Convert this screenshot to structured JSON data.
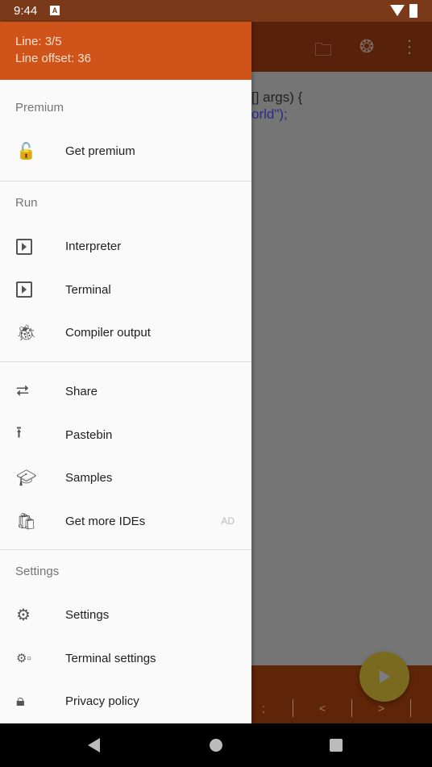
{
  "status_bar": {
    "time": "9:44",
    "notification": "A"
  },
  "editor": {
    "line1": "[] args) {",
    "line2": "orld\");"
  },
  "bottom_bar": {
    "symbols": [
      ";",
      "<",
      ">"
    ]
  },
  "drawer": {
    "header": {
      "line": "Line: 3/5",
      "offset": "Line offset: 36"
    },
    "sections": [
      {
        "title": "Premium",
        "items": [
          {
            "label": "Get premium",
            "icon": "lock-open-icon"
          }
        ]
      },
      {
        "title": "Run",
        "items": [
          {
            "label": "Interpreter",
            "icon": "play-box-icon"
          },
          {
            "label": "Terminal",
            "icon": "play-box-icon"
          },
          {
            "label": "Compiler output",
            "icon": "bug-icon"
          }
        ]
      },
      {
        "title": "",
        "items": [
          {
            "label": "Share",
            "icon": "share-icon"
          },
          {
            "label": "Pastebin",
            "icon": "upload-icon"
          },
          {
            "label": "Samples",
            "icon": "school-icon"
          },
          {
            "label": "Get more IDEs",
            "icon": "shop-icon",
            "badge": "AD"
          }
        ]
      },
      {
        "title": "Settings",
        "items": [
          {
            "label": "Settings",
            "icon": "gear-icon"
          },
          {
            "label": "Terminal settings",
            "icon": "gear-box-icon"
          },
          {
            "label": "Privacy policy",
            "icon": "lock-icon"
          }
        ]
      }
    ]
  }
}
